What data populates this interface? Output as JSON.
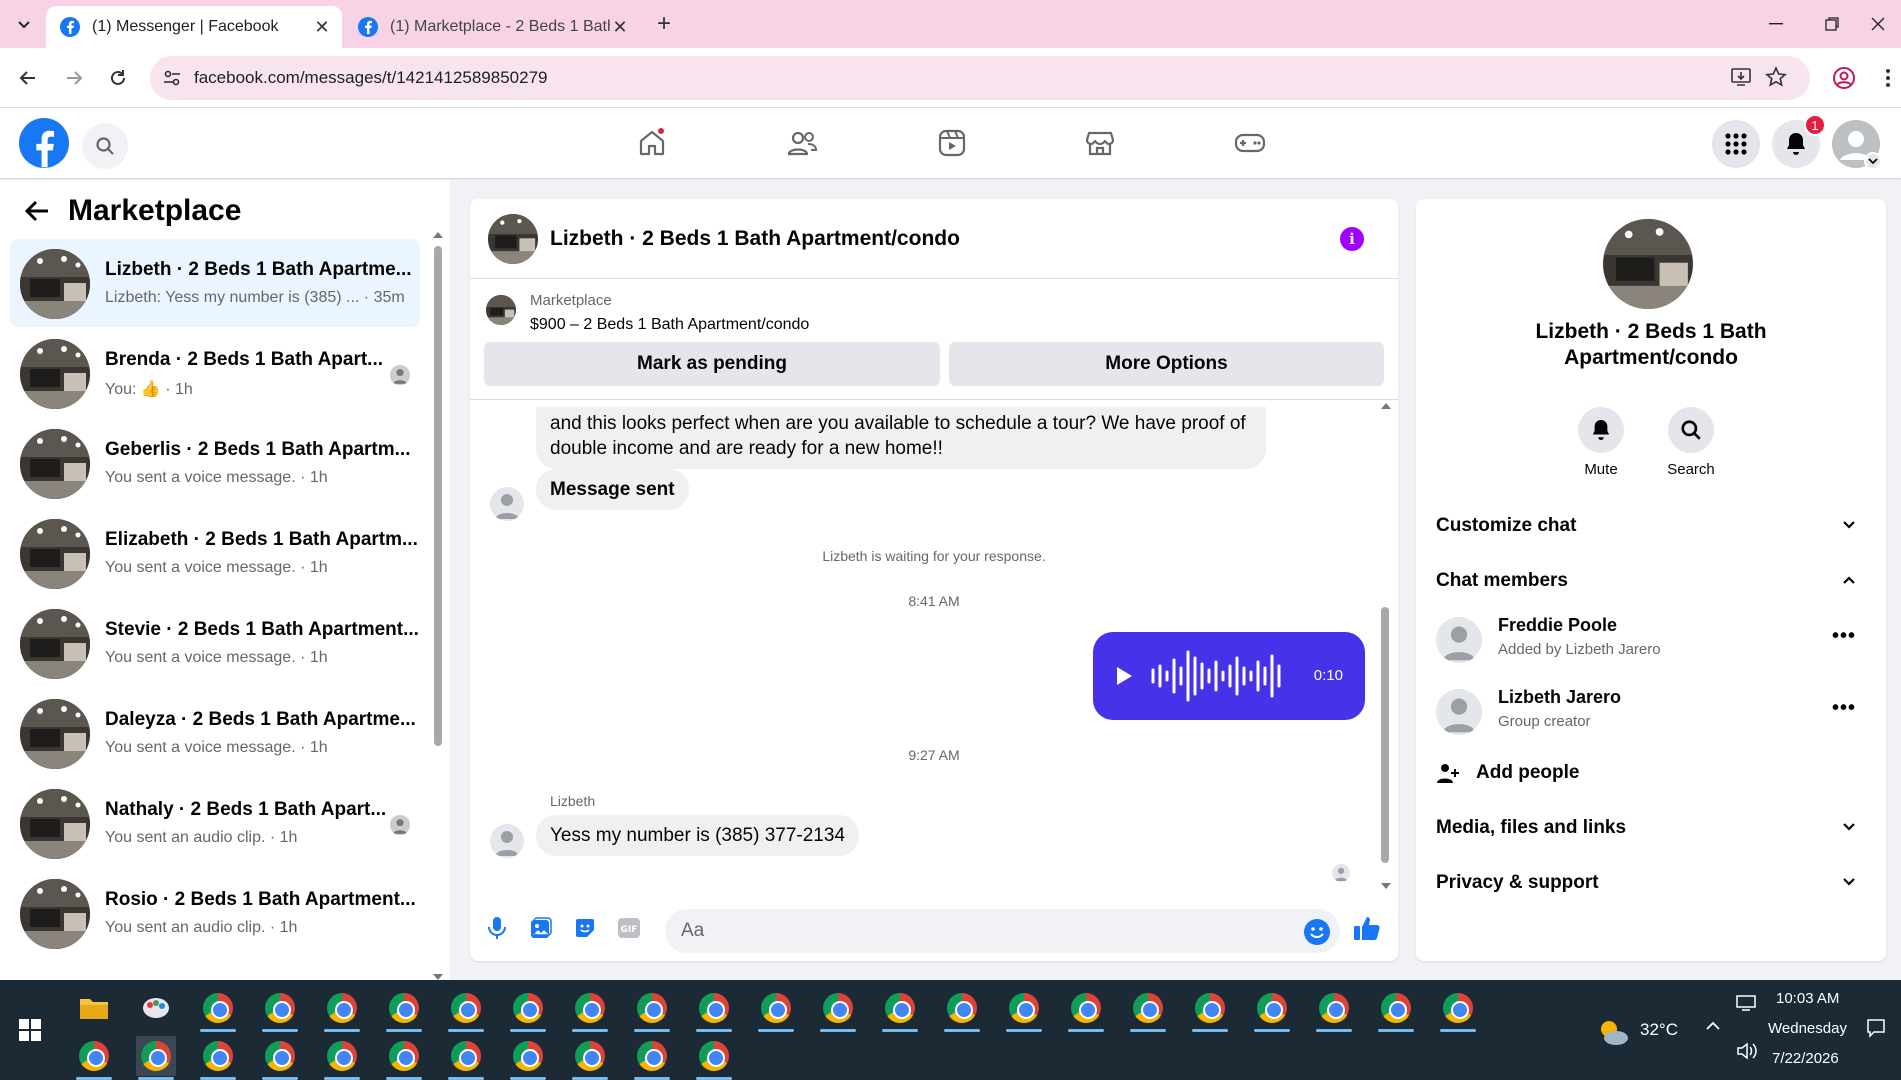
{
  "browser": {
    "tabs": [
      {
        "title": "(1) Messenger | Facebook",
        "active": true
      },
      {
        "title": "(1) Marketplace - 2 Beds 1 Bath",
        "active": false
      }
    ],
    "url": "facebook.com/messages/t/1421412589850279"
  },
  "fb": {
    "nav": [
      "home-icon",
      "friends-icon",
      "watch-icon",
      "marketplace-icon",
      "gaming-icon"
    ],
    "notif_count": "1"
  },
  "left": {
    "title": "Marketplace",
    "conversations": [
      {
        "name": "Lizbeth · 2 Beds 1 Bath Apartme...",
        "sub": "Lizbeth: Yess my number is (385) ... · 35m"
      },
      {
        "name": "Brenda · 2 Beds 1 Bath Apart...",
        "sub": "You: 👍 · 1h"
      },
      {
        "name": "Geberlis · 2 Beds 1 Bath Apartm...",
        "sub": "You sent a voice message. · 1h"
      },
      {
        "name": "Elizabeth · 2 Beds 1 Bath Apartm...",
        "sub": "You sent a voice message. · 1h"
      },
      {
        "name": "Stevie · 2 Beds 1 Bath Apartment...",
        "sub": "You sent a voice message. · 1h"
      },
      {
        "name": "Daleyza · 2 Beds 1 Bath Apartme...",
        "sub": "You sent a voice message. · 1h"
      },
      {
        "name": "Nathaly · 2 Beds 1 Bath Apart...",
        "sub": "You sent an audio clip. · 1h"
      },
      {
        "name": "Rosio · 2 Beds 1 Bath Apartment...",
        "sub": "You sent an audio clip. · 1h"
      }
    ]
  },
  "chat": {
    "title": "Lizbeth · 2 Beds 1 Bath Apartment/condo",
    "marketplace_label": "Marketplace",
    "listing": "$900 – 2 Beds 1 Bath Apartment/condo",
    "btn_pending": "Mark as pending",
    "btn_more": "More Options",
    "msg1": "and this looks perfect when are you available to schedule a tour? We have proof of double income and are ready for a new home!!",
    "msg2": "Message sent",
    "waiting": "Lizbeth is waiting for your response.",
    "time1": "8:41 AM",
    "voice_duration": "0:10",
    "time2": "9:27 AM",
    "sender": "Lizbeth",
    "msg3": "Yess my number is (385) 377-2134",
    "composer_placeholder": "Aa"
  },
  "right": {
    "name": "Lizbeth · 2 Beds 1 Bath Apartment/condo",
    "mute": "Mute",
    "search": "Search",
    "customize": "Customize chat",
    "members_title": "Chat members",
    "members": [
      {
        "name": "Freddie Poole",
        "sub": "Added by Lizbeth Jarero"
      },
      {
        "name": "Lizbeth Jarero",
        "sub": "Group creator"
      }
    ],
    "add_people": "Add people",
    "media": "Media, files and links",
    "privacy": "Privacy & support"
  },
  "taskbar": {
    "temp": "32°C",
    "time": "10:03 AM",
    "day": "Wednesday",
    "date": "7/22/2026"
  }
}
